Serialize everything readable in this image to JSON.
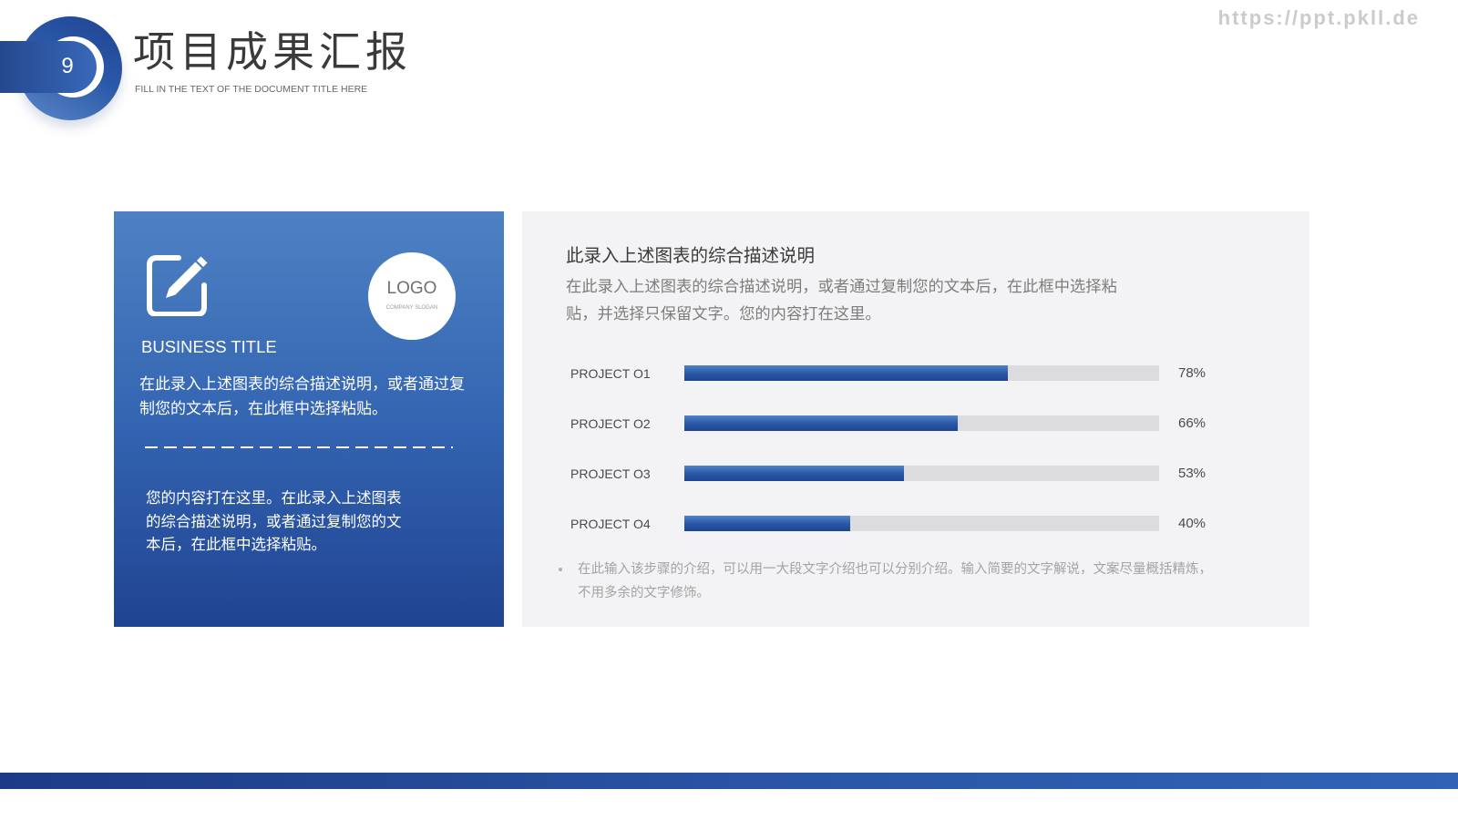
{
  "theme": {
    "primary_dark": "#1f4391",
    "primary_light": "#4e81c3",
    "track": "#dcdcdf",
    "panel_bg": "#f3f3f5"
  },
  "header": {
    "slide_number": "9",
    "title": "项目成果汇报",
    "subtitle": "FILL IN THE TEXT OF THE DOCUMENT TITLE HERE",
    "watermark": "https://ppt.pkll.de"
  },
  "left_card": {
    "icon": "edit-icon",
    "logo": {
      "text": "LOGO",
      "slogan": "COMPANY SLOGAN"
    },
    "title": "BUSINESS TITLE",
    "description": "在此录入上述图表的综合描述说明，或者通过复制您的文本后，在此框中选择粘贴。",
    "body": "您的内容打在这里。在此录入上述图表的综合描述说明，或者通过复制您的文本后，在此框中选择粘贴。"
  },
  "right_card": {
    "heading": "此录入上述图表的综合描述说明",
    "description": "在此录入上述图表的综合描述说明，或者通过复制您的文本后，在此框中选择粘贴，并选择只保留文字。您的内容打在这里。",
    "note_icon": "bullet-icon",
    "note": "在此输入该步骤的介绍，可以用一大段文字介绍也可以分别介绍。输入简要的文字解说，文案尽量概括精炼，不用多余的文字修饰。"
  },
  "chart_data": {
    "type": "bar",
    "orientation": "horizontal",
    "categories": [
      "PROJECT O1",
      "PROJECT O2",
      "PROJECT O3",
      "PROJECT O4"
    ],
    "values": [
      78,
      66,
      53,
      40
    ],
    "value_labels": [
      "78%",
      "66%",
      "53%",
      "40%"
    ],
    "grid": false
  }
}
